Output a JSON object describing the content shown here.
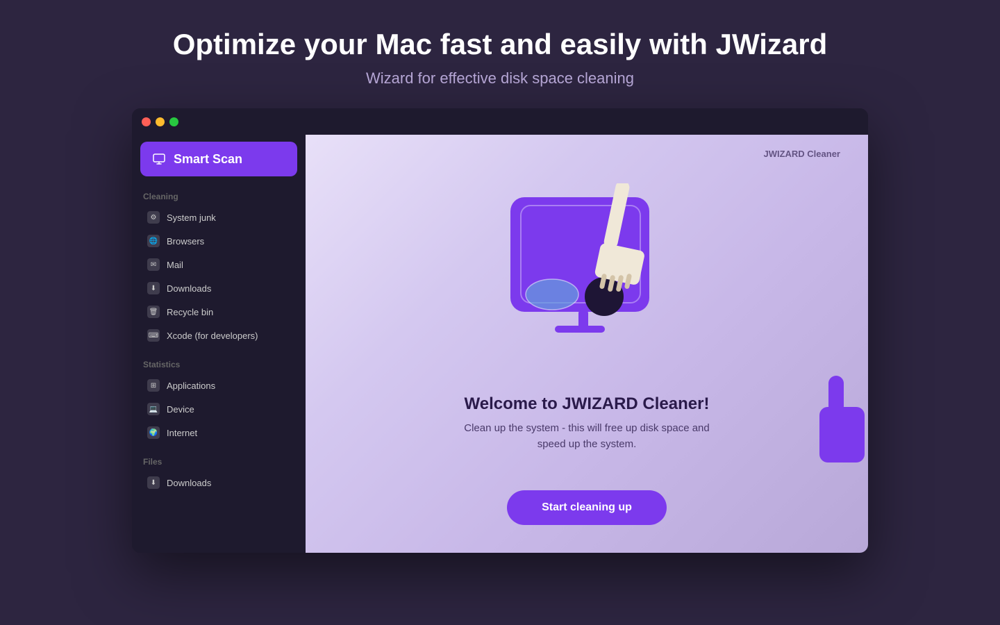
{
  "header": {
    "title": "Optimize your Mac fast and easily with JWizard",
    "subtitle": "Wizard for effective disk space cleaning"
  },
  "titlebar": {
    "traffic_lights": [
      "red",
      "yellow",
      "green"
    ]
  },
  "sidebar": {
    "smart_scan_label": "Smart Scan",
    "smart_scan_icon": "monitor-icon",
    "sections": [
      {
        "title": "Cleaning",
        "items": [
          {
            "label": "System junk",
            "icon": "gear-icon"
          },
          {
            "label": "Browsers",
            "icon": "globe-icon"
          },
          {
            "label": "Mail",
            "icon": "mail-icon"
          },
          {
            "label": "Downloads",
            "icon": "download-icon"
          },
          {
            "label": "Recycle bin",
            "icon": "trash-icon"
          },
          {
            "label": "Xcode (for developers)",
            "icon": "xcode-icon"
          }
        ]
      },
      {
        "title": "Statistics",
        "items": [
          {
            "label": "Applications",
            "icon": "app-icon"
          },
          {
            "label": "Device",
            "icon": "device-icon"
          },
          {
            "label": "Internet",
            "icon": "internet-icon"
          }
        ]
      },
      {
        "title": "Files",
        "items": [
          {
            "label": "Downloads",
            "icon": "download-icon"
          }
        ]
      }
    ]
  },
  "main": {
    "app_title": "JWIZARD Cleaner",
    "welcome_title": "Welcome to JWIZARD Cleaner!",
    "welcome_desc": "Clean up the system - this will free up disk space and speed up the system.",
    "start_button_label": "Start cleaning up"
  }
}
